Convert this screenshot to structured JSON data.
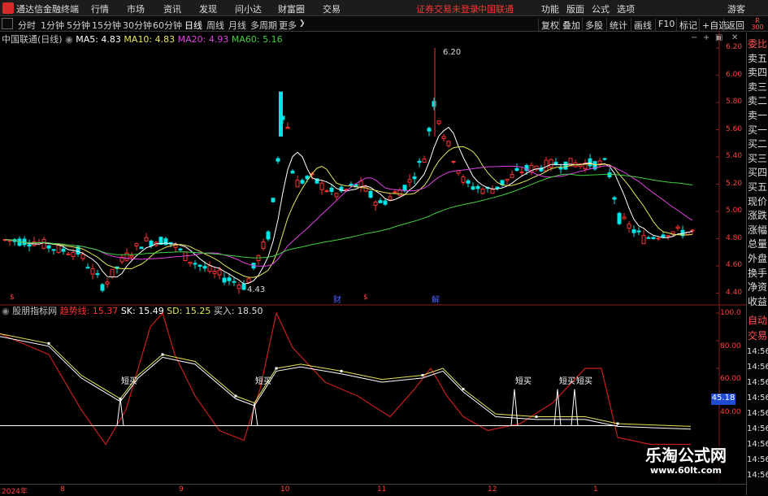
{
  "app": {
    "title": "通达信金融终端",
    "status_warning": "证券交易未登录",
    "stock_name": "中国联通"
  },
  "menu": [
    "行情",
    "市场",
    "资讯",
    "发现",
    "问小达",
    "财富圈",
    "交易"
  ],
  "top_right": [
    "功能",
    "版面",
    "公式",
    "选项",
    "游客"
  ],
  "tabs": [
    "分时",
    "1分钟",
    "5分钟",
    "15分钟",
    "30分钟",
    "60分钟",
    "日线",
    "周线",
    "月线",
    "多周期",
    "更多"
  ],
  "active_tab": "日线",
  "tab_tools": [
    "复权",
    "叠加",
    "多股",
    "统计",
    "画线",
    "F10",
    "标记",
    "+自选",
    "返回"
  ],
  "main_legend": {
    "name": "中国联通(日线)",
    "ma5": "MA5: 4.83",
    "ma10": "MA10: 4.83",
    "ma20": "MA20: 4.93",
    "ma60": "MA60: 5.16"
  },
  "price_axis": [
    "6.20",
    "6.00",
    "5.80",
    "5.60",
    "5.40",
    "5.20",
    "5.00",
    "4.80",
    "4.60",
    "4.40"
  ],
  "annotations": {
    "high": "6.20",
    "low": "4.43",
    "markers": [
      "财",
      "$",
      "解",
      "$"
    ]
  },
  "indicator_legend": {
    "name": "股朋指标网",
    "trend": "趋势线: 15.37",
    "sk": "SK: 15.49",
    "sd": "SD: 15.25",
    "buy": "买入: 18.50"
  },
  "indicator_axis": [
    "100.0",
    "80.00",
    "60.00",
    "40.00"
  ],
  "current_value": "45.18",
  "signal_label": "短买",
  "date_axis": [
    "2024年",
    "8",
    "9",
    "10",
    "11",
    "12",
    "1"
  ],
  "right_panel": [
    "委比",
    "卖五",
    "卖四",
    "卖三",
    "卖二",
    "卖一",
    "买一",
    "买二",
    "买三",
    "买四",
    "买五",
    "现价",
    "涨跌",
    "涨幅",
    "总量",
    "外盘",
    "换手",
    "净资",
    "收益"
  ],
  "right_panel_bottom": [
    "自动",
    "交易",
    "14:56",
    "14:56",
    "14:56",
    "14:56",
    "14:56",
    "14:56",
    "14:56",
    "14:56",
    "14:56"
  ],
  "axis_top_right": [
    "R",
    "300"
  ],
  "watermark": {
    "title": "乐淘公式网",
    "url": "www.60lt.com"
  },
  "colors": {
    "up": "#ff3232",
    "down": "#00e6e6",
    "ma5": "#ffffff",
    "ma10": "#e6e65a",
    "ma20": "#e040e0",
    "ma60": "#40d040",
    "indicator": "#c81e1e"
  }
}
